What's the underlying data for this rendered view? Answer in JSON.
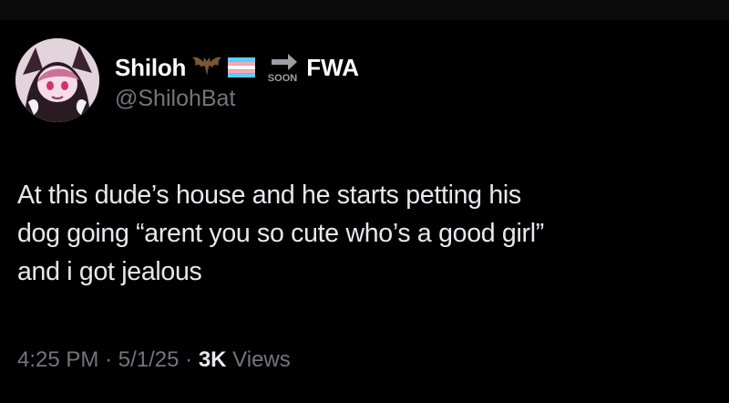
{
  "author": {
    "display_name": "Shiloh",
    "name_suffix": "FWA",
    "handle": "@ShilohBat",
    "name_emojis": [
      "bat-emoji",
      "transgender-flag-emoji",
      "soon-arrow-emoji"
    ],
    "soon_label": "SOON"
  },
  "tweet": {
    "lines": [
      "At this dude’s house and he starts petting his",
      "dog going “arent you so cute who’s a good girl”",
      "and i got jealous"
    ]
  },
  "meta": {
    "time": "4:25 PM",
    "date": "5/1/25",
    "views_count": "3K",
    "views_label": "Views",
    "separator": "·"
  },
  "colors": {
    "background": "#000000",
    "primary_text": "#e7e9ea",
    "secondary_text": "#71767b",
    "trans_blue": "#5bcefa",
    "trans_pink": "#f5a9b8",
    "trans_white": "#ffffff"
  }
}
